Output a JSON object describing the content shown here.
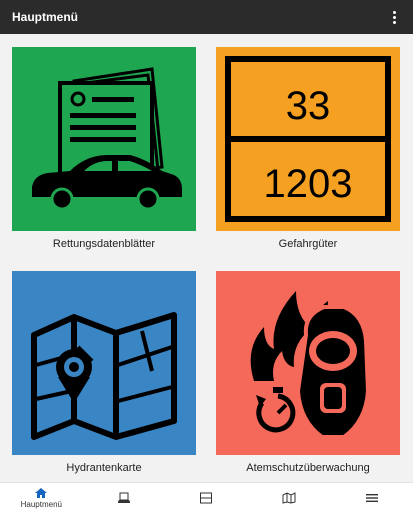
{
  "appbar": {
    "title": "Hauptmenü",
    "menu_icon": "more-vert-icon"
  },
  "tiles": [
    {
      "label": "Rettungsdatenblätter",
      "color": "#1fa651",
      "icon": "rescue-sheet-car-icon"
    },
    {
      "label": "Gefahrgüter",
      "color": "#f5a020",
      "icon": "hazard-plate-icon",
      "hazard_number": "33",
      "un_number": "1203"
    },
    {
      "label": "Hydrantenkarte",
      "color": "#3a85c4",
      "icon": "hydrant-map-icon"
    },
    {
      "label": "Atemschutzüberwachung",
      "color": "#f5695a",
      "icon": "breathing-mask-fire-icon"
    }
  ],
  "navbar": {
    "active_color": "#1565c0",
    "items": [
      {
        "label": "Hauptmenü",
        "icon": "home-icon"
      },
      {
        "label": "",
        "icon": "car-document-icon"
      },
      {
        "label": "",
        "icon": "hazard-plate-icon"
      },
      {
        "label": "",
        "icon": "map-icon"
      },
      {
        "label": "",
        "icon": "hamburger-menu-icon"
      }
    ]
  }
}
